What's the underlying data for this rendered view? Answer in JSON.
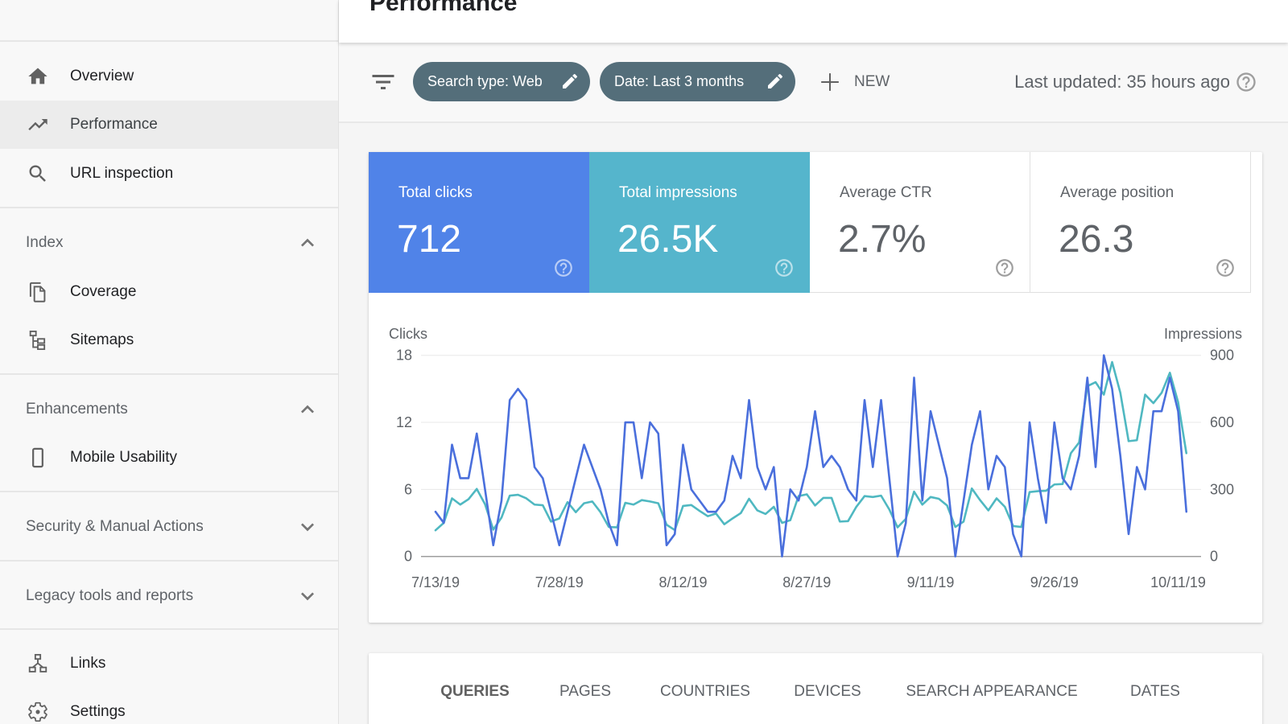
{
  "header": {
    "title": "Performance"
  },
  "sidebar": {
    "top_items": [
      {
        "label": "Overview",
        "icon": "home-icon"
      },
      {
        "label": "Performance",
        "icon": "trending-up-icon",
        "selected": true
      },
      {
        "label": "URL inspection",
        "icon": "search-icon"
      }
    ],
    "sections": [
      {
        "title": "Index",
        "expanded": true,
        "items": [
          {
            "label": "Coverage",
            "icon": "coverage-icon"
          },
          {
            "label": "Sitemaps",
            "icon": "sitemap-icon"
          }
        ]
      },
      {
        "title": "Enhancements",
        "expanded": true,
        "items": [
          {
            "label": "Mobile Usability",
            "icon": "mobile-icon"
          }
        ]
      },
      {
        "title": "Security & Manual Actions",
        "expanded": false,
        "items": []
      },
      {
        "title": "Legacy tools and reports",
        "expanded": false,
        "items": []
      }
    ],
    "bottom_items": [
      {
        "label": "Links",
        "icon": "links-icon"
      },
      {
        "label": "Settings",
        "icon": "gear-icon"
      }
    ]
  },
  "toolbar": {
    "filter_icon": "filter-icon",
    "chips": [
      {
        "label": "Search type: Web",
        "icon": "pencil-icon"
      },
      {
        "label": "Date: Last 3 months",
        "icon": "pencil-icon"
      }
    ],
    "new_label": "NEW",
    "last_updated": "Last updated: 35 hours ago"
  },
  "metrics": [
    {
      "label": "Total clicks",
      "value": "712",
      "selected": true,
      "color": "#5083e8"
    },
    {
      "label": "Total impressions",
      "value": "26.5K",
      "selected": true,
      "color": "#55b5cc"
    },
    {
      "label": "Average CTR",
      "value": "2.7%",
      "selected": false
    },
    {
      "label": "Average position",
      "value": "26.3",
      "selected": false
    }
  ],
  "tabs": {
    "items": [
      "QUERIES",
      "PAGES",
      "COUNTRIES",
      "DEVICES",
      "SEARCH APPEARANCE",
      "DATES"
    ],
    "active": "QUERIES"
  },
  "chart_data": {
    "type": "line",
    "title": "",
    "x": [
      "7/13/19",
      "7/14/19",
      "7/15/19",
      "7/16/19",
      "7/17/19",
      "7/18/19",
      "7/19/19",
      "7/20/19",
      "7/21/19",
      "7/22/19",
      "7/23/19",
      "7/24/19",
      "7/25/19",
      "7/26/19",
      "7/27/19",
      "7/28/19",
      "7/29/19",
      "7/30/19",
      "7/31/19",
      "8/1/19",
      "8/2/19",
      "8/3/19",
      "8/4/19",
      "8/5/19",
      "8/6/19",
      "8/7/19",
      "8/8/19",
      "8/9/19",
      "8/10/19",
      "8/11/19",
      "8/12/19",
      "8/13/19",
      "8/14/19",
      "8/15/19",
      "8/16/19",
      "8/17/19",
      "8/18/19",
      "8/19/19",
      "8/20/19",
      "8/21/19",
      "8/22/19",
      "8/23/19",
      "8/24/19",
      "8/25/19",
      "8/26/19",
      "8/27/19",
      "8/28/19",
      "8/29/19",
      "8/30/19",
      "8/31/19",
      "9/1/19",
      "9/2/19",
      "9/3/19",
      "9/4/19",
      "9/5/19",
      "9/6/19",
      "9/7/19",
      "9/8/19",
      "9/9/19",
      "9/10/19",
      "9/11/19",
      "9/12/19",
      "9/13/19",
      "9/14/19",
      "9/15/19",
      "9/16/19",
      "9/17/19",
      "9/18/19",
      "9/19/19",
      "9/20/19",
      "9/21/19",
      "9/22/19",
      "9/23/19",
      "9/24/19",
      "9/25/19",
      "9/26/19",
      "9/27/19",
      "9/28/19",
      "9/29/19",
      "9/30/19",
      "10/1/19",
      "10/2/19",
      "10/3/19",
      "10/4/19",
      "10/5/19",
      "10/6/19",
      "10/7/19",
      "10/8/19",
      "10/9/19",
      "10/10/19",
      "10/11/19",
      "10/12/19"
    ],
    "x_ticks": [
      "7/13/19",
      "7/28/19",
      "8/12/19",
      "8/27/19",
      "9/11/19",
      "9/26/19",
      "10/11/19"
    ],
    "series": [
      {
        "name": "Clicks",
        "axis": "left",
        "color": "#4a6fdc",
        "values": [
          4,
          3,
          10,
          7,
          7,
          11,
          6,
          1,
          5,
          14,
          15,
          14,
          8,
          7,
          4,
          1,
          4,
          7,
          10,
          8,
          6,
          3,
          1,
          12,
          12,
          7,
          12,
          11,
          1,
          2,
          10,
          6,
          5,
          4,
          4,
          5,
          9,
          7,
          14,
          8,
          6,
          8,
          0,
          6,
          5,
          8,
          13,
          8,
          9,
          8,
          6,
          5,
          14,
          8,
          14,
          7,
          0,
          3,
          16,
          5,
          13,
          10,
          7,
          0,
          5,
          10,
          13,
          6,
          9,
          8,
          2,
          0,
          12,
          7,
          3,
          12,
          7,
          6,
          9,
          16,
          8,
          18,
          15,
          9,
          2,
          8,
          6,
          13,
          13,
          16,
          13,
          4
        ]
      },
      {
        "name": "Impressions",
        "axis": "right",
        "color": "#4fb8c1",
        "values": [
          117,
          150,
          260,
          232,
          256,
          302,
          234,
          120,
          174,
          272,
          276,
          260,
          232,
          229,
          156,
          170,
          243,
          198,
          238,
          246,
          198,
          132,
          130,
          240,
          232,
          252,
          246,
          238,
          142,
          118,
          226,
          230,
          204,
          180,
          192,
          144,
          170,
          194,
          258,
          206,
          190,
          222,
          150,
          162,
          270,
          278,
          228,
          262,
          262,
          156,
          158,
          222,
          270,
          266,
          272,
          210,
          130,
          168,
          290,
          232,
          266,
          258,
          228,
          132,
          156,
          304,
          252,
          206,
          260,
          222,
          136,
          132,
          288,
          292,
          294,
          322,
          324,
          462,
          510,
          762,
          780,
          724,
          870,
          732,
          516,
          520,
          724,
          686,
          732,
          822,
          690,
          462
        ]
      }
    ],
    "left_axis": {
      "label": "Clicks",
      "ticks": [
        0,
        6,
        12,
        18
      ],
      "range": [
        0,
        18
      ]
    },
    "right_axis": {
      "label": "Impressions",
      "ticks": [
        0,
        300,
        600,
        900
      ],
      "range": [
        0,
        900
      ]
    },
    "xlabel": "",
    "grid": true,
    "legend": "none"
  }
}
